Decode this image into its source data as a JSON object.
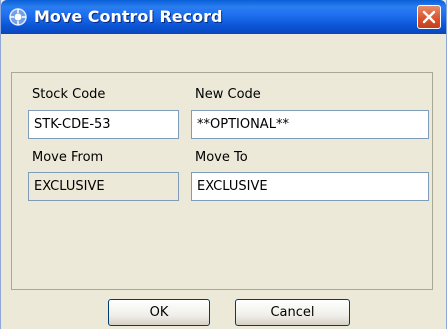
{
  "window": {
    "title": "Move Control Record",
    "icon": "app-icon",
    "close_icon": "close-icon"
  },
  "form": {
    "stock_code_label": "Stock Code",
    "stock_code_value": "STK-CDE-53",
    "new_code_label": "New Code",
    "new_code_value": "**OPTIONAL**",
    "move_from_label": "Move From",
    "move_from_value": "EXCLUSIVE",
    "move_to_label": "Move To",
    "move_to_value": "EXCLUSIVE"
  },
  "buttons": {
    "ok_label": "OK",
    "cancel_label": "Cancel"
  },
  "colors": {
    "titlebar": "#0b56d6",
    "close": "#d8502a",
    "dialog_bg": "#ece9d8"
  }
}
